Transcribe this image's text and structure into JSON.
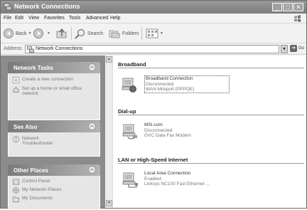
{
  "window": {
    "title": "Network Connections"
  },
  "menu": [
    "File",
    "Edit",
    "View",
    "Favorites",
    "Tools",
    "Advanced",
    "Help"
  ],
  "toolbar": {
    "back_label": "Back",
    "search_label": "Search",
    "folders_label": "Folders"
  },
  "address": {
    "label": "Address",
    "value": "Network Connections",
    "go_label": "Go"
  },
  "sidebar": {
    "network_tasks": {
      "title": "Network Tasks",
      "items": [
        {
          "label": "Create a new connection",
          "icon": "new-connection-icon"
        },
        {
          "label": "Set up a home or small office network",
          "icon": "home-network-icon"
        }
      ]
    },
    "see_also": {
      "title": "See Also",
      "items": [
        {
          "label": "Network Troubleshooter",
          "icon": "help-icon"
        }
      ]
    },
    "other_places": {
      "title": "Other Places",
      "items": [
        {
          "label": "Control Panel",
          "icon": "control-panel-icon"
        },
        {
          "label": "My Network Places",
          "icon": "network-places-icon"
        },
        {
          "label": "My Documents",
          "icon": "documents-icon"
        }
      ]
    }
  },
  "groups": [
    {
      "title": "Broadband",
      "connections": [
        {
          "name": "Broadband Connection",
          "status": "Disconnected",
          "device": "WAN Miniport (PPPOE)",
          "selected": true
        }
      ]
    },
    {
      "title": "Dial-up",
      "connections": [
        {
          "name": "MSI.com",
          "status": "Disconnected",
          "device": "GVC Data Fax Modem",
          "selected": false
        }
      ]
    },
    {
      "title": "LAN or High-Speed Internet",
      "connections": [
        {
          "name": "Local Area Connection",
          "status": "Enabled",
          "device": "Linksys NC100 Fast Ethernet ...",
          "selected": false
        }
      ]
    }
  ],
  "colors": {
    "titlebar": "#8a8a8a",
    "sidebar_bg": "#8c8c8c",
    "panel_body": "#e6e6e6"
  }
}
